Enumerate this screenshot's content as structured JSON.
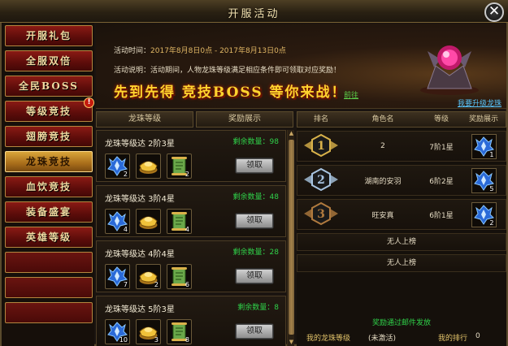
{
  "window": {
    "title": "开服活动",
    "close_icon": "close-icon"
  },
  "sidebar": {
    "items": [
      {
        "label": "开服礼包",
        "active": false,
        "badge": ""
      },
      {
        "label": "全服双倍",
        "active": false,
        "badge": ""
      },
      {
        "label": "全民BOSS",
        "active": false,
        "badge": ""
      },
      {
        "label": "等级竞技",
        "active": false,
        "badge": "!"
      },
      {
        "label": "翅膀竞技",
        "active": false,
        "badge": ""
      },
      {
        "label": "龙珠竞技",
        "active": true,
        "badge": ""
      },
      {
        "label": "血饮竞技",
        "active": false,
        "badge": ""
      },
      {
        "label": "装备盛宴",
        "active": false,
        "badge": ""
      },
      {
        "label": "英雄等级",
        "active": false,
        "badge": ""
      },
      {
        "label": "",
        "active": false,
        "badge": ""
      },
      {
        "label": "",
        "active": false,
        "badge": ""
      },
      {
        "label": "",
        "active": false,
        "badge": ""
      }
    ]
  },
  "banner": {
    "time_label": "活动时间：",
    "time_value": "2017年8月8日0点 - 2017年8月13日0点",
    "desc_label": "活动说明：",
    "desc_value": "活动期间，人物龙珠等级满足相应条件即可领取对应奖励！",
    "slogan": "先到先得 竞技BOSS 等你来战！",
    "slogan_link": "前往",
    "upgrade_link": "我要升级龙珠"
  },
  "left_tabs": [
    "龙珠等级",
    "奖励展示"
  ],
  "cards": [
    {
      "title": "龙珠等级达 2阶3星",
      "remaining_label": "剩余数量：",
      "remaining": "98",
      "items": [
        {
          "icon": "blue-crystal-icon",
          "count": "2"
        },
        {
          "icon": "gold-ingot-icon",
          "count": ""
        },
        {
          "icon": "scroll-icon",
          "count": "2"
        }
      ],
      "button": "领取"
    },
    {
      "title": "龙珠等级达 3阶4星",
      "remaining_label": "剩余数量：",
      "remaining": "48",
      "items": [
        {
          "icon": "blue-crystal-icon",
          "count": "4"
        },
        {
          "icon": "gold-ingot-icon",
          "count": ""
        },
        {
          "icon": "scroll-icon",
          "count": "4"
        }
      ],
      "button": "领取"
    },
    {
      "title": "龙珠等级达 4阶4星",
      "remaining_label": "剩余数量：",
      "remaining": "28",
      "items": [
        {
          "icon": "blue-crystal-icon",
          "count": "7"
        },
        {
          "icon": "gold-ingot-icon",
          "count": "2"
        },
        {
          "icon": "scroll-icon",
          "count": "6"
        }
      ],
      "button": "领取"
    },
    {
      "title": "龙珠等级达 5阶3星",
      "remaining_label": "剩余数量：",
      "remaining": "8",
      "items": [
        {
          "icon": "blue-crystal-icon",
          "count": "10"
        },
        {
          "icon": "gold-ingot-icon",
          "count": "3"
        },
        {
          "icon": "scroll-icon",
          "count": "8"
        }
      ],
      "button": "领取"
    }
  ],
  "ranking": {
    "headers": [
      "排名",
      "角色名",
      "等级",
      "奖励展示"
    ],
    "rows": [
      {
        "rank": "1",
        "name": "2",
        "level": "7阶1星",
        "reward_count": "1",
        "medal_color": "#d9b24a"
      },
      {
        "rank": "2",
        "name": "湖南的安羽",
        "level": "6阶2星",
        "reward_count": "5",
        "medal_color": "#a8c4e0"
      },
      {
        "rank": "3",
        "name": "旺安真",
        "level": "6阶1星",
        "reward_count": "2",
        "medal_color": "#b07a3e"
      }
    ],
    "empty_rows": [
      "无人上榜",
      "无人上榜"
    ],
    "mail_note": "奖励通过邮件发放",
    "my_level_label": "我的龙珠等级",
    "my_level_value": "(未激活)",
    "my_rank_label": "我的排行",
    "my_rank_value": "0"
  }
}
